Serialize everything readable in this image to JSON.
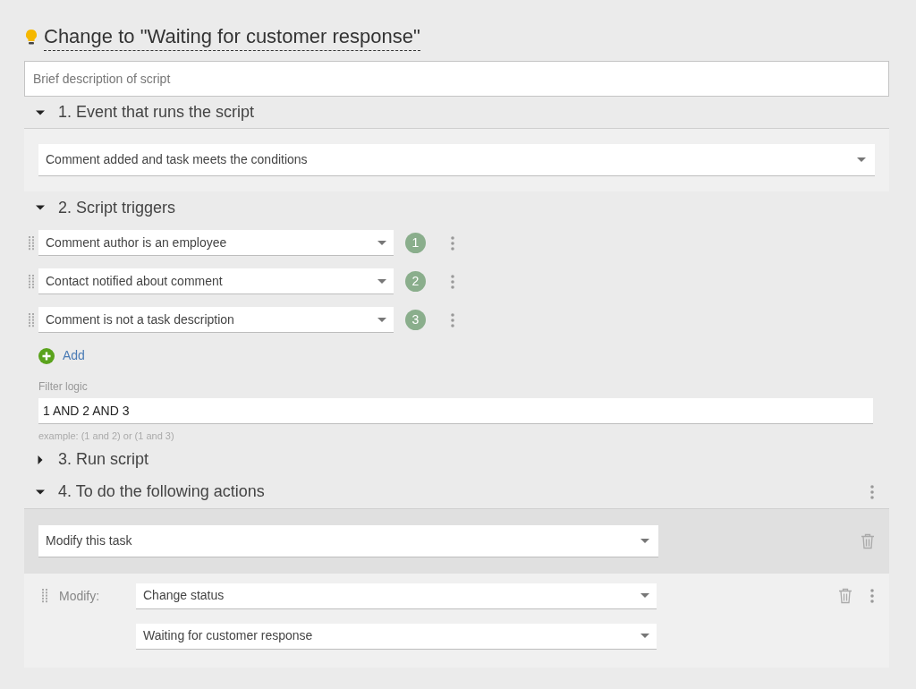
{
  "title": "Change to \"Waiting for customer response\"",
  "description": {
    "placeholder": "Brief description of script"
  },
  "sections": [
    {
      "kind": "event",
      "label": "1. Event that runs the script",
      "expanded": true,
      "select": "Comment added and task meets the conditions"
    },
    {
      "kind": "triggers",
      "label": "2. Script triggers",
      "expanded": true,
      "triggers": [
        {
          "label": "Comment author is an employee",
          "number": "1"
        },
        {
          "label": "Contact notified about comment",
          "number": "2"
        },
        {
          "label": "Comment is not a task description",
          "number": "3"
        }
      ],
      "add_label": "Add",
      "filter_label": "Filter logic",
      "filter_value": "1 AND 2 AND 3",
      "filter_hint": "example: (1 and 2) or (1 and 3)"
    },
    {
      "kind": "run",
      "label": "3. Run script",
      "expanded": false
    },
    {
      "kind": "actions",
      "label": "4. To do the following actions",
      "expanded": true,
      "action": "Modify this task",
      "modify_label": "Modify:",
      "modify_field": "Change status",
      "modify_value": "Waiting for customer response"
    }
  ]
}
